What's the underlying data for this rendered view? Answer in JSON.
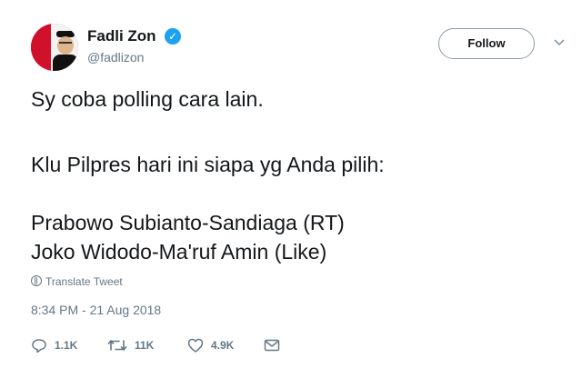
{
  "author": {
    "name": "Fadli Zon",
    "handle": "@fadlizon",
    "verified": true
  },
  "follow_button": {
    "label": "Follow"
  },
  "tweet": {
    "lines": [
      "Sy coba polling cara lain.",
      "Klu Pilpres hari ini siapa yg Anda pilih:",
      "Prabowo Subianto-Sandiaga (RT)",
      "Joko Widodo-Ma'ruf Amin (Like)"
    ],
    "translate_label": "Translate Tweet",
    "timestamp": "8:34 PM - 21 Aug 2018"
  },
  "actions": {
    "replies": "1.1K",
    "retweets": "11K",
    "likes": "4.9K"
  },
  "icons": {
    "reply": "reply-icon",
    "retweet": "retweet-icon",
    "like": "heart-icon",
    "message": "envelope-icon",
    "verified": "verified-badge-icon",
    "more": "chevron-down-icon",
    "translate": "globe-icon"
  },
  "colors": {
    "verified": "#1da1f2",
    "secondary_text": "#657786"
  }
}
